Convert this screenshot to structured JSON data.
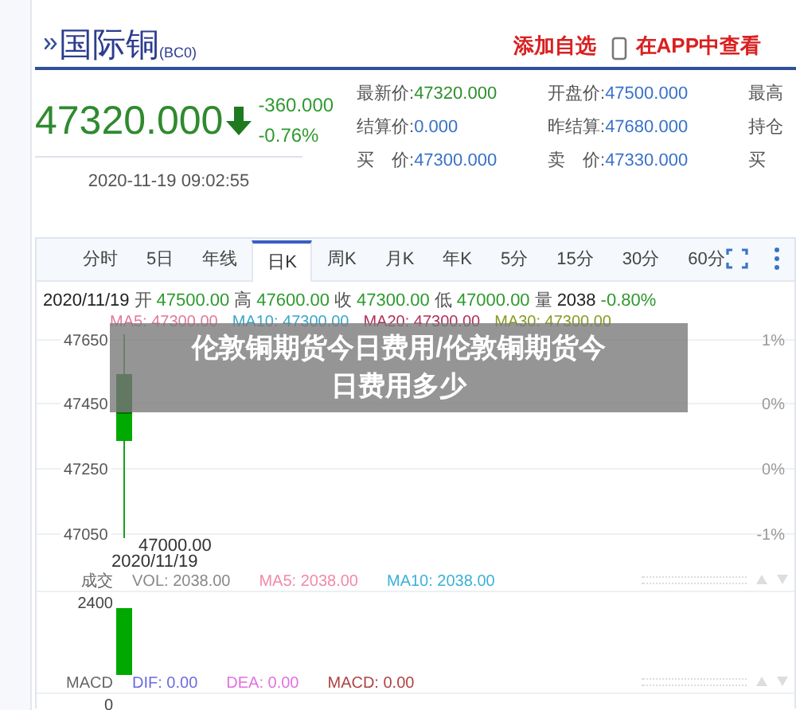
{
  "header": {
    "title": "国际铜",
    "code": "(BC0)",
    "add_watchlist": "添加自选",
    "open_in_app": "在APP中查看"
  },
  "quote": {
    "price": "47320.000",
    "change": "-360.000",
    "change_pct": "-0.76%",
    "time": "2020-11-19 09:02:55"
  },
  "stats": [
    [
      {
        "label": "最新价:",
        "value": "47320.000",
        "color": "#2f8f2f"
      },
      {
        "label": "结算价:",
        "value": "0.000",
        "color": "#3a72c8"
      },
      {
        "label": "买　价:",
        "value": "47300.000",
        "color": "#3a72c8"
      }
    ],
    [
      {
        "label": "开盘价:",
        "value": "47500.000",
        "color": "#3a72c8"
      },
      {
        "label": "昨结算:",
        "value": "47680.000",
        "color": "#3a72c8"
      },
      {
        "label": "卖　价:",
        "value": "47330.000",
        "color": "#3a72c8"
      }
    ],
    [
      {
        "label": "最高"
      },
      {
        "label": "持仓"
      },
      {
        "label": "买"
      }
    ]
  ],
  "tabs": [
    {
      "label": "分时",
      "selected": false
    },
    {
      "label": "5日",
      "selected": false
    },
    {
      "label": "年线",
      "selected": false
    },
    {
      "label": "日K",
      "selected": true
    },
    {
      "label": "周K",
      "selected": false
    },
    {
      "label": "月K",
      "selected": false
    },
    {
      "label": "年K",
      "selected": false
    },
    {
      "label": "5分",
      "selected": false
    },
    {
      "label": "15分",
      "selected": false
    },
    {
      "label": "30分",
      "selected": false
    },
    {
      "label": "60分",
      "selected": false
    }
  ],
  "ohlc": [
    {
      "text": "2020/11/19",
      "color": "#222222"
    },
    {
      "text": "开",
      "color": "#555555"
    },
    {
      "text": "47500.00",
      "color": "#2f9a2f"
    },
    {
      "text": "高",
      "color": "#555555"
    },
    {
      "text": "47600.00",
      "color": "#2f9a2f"
    },
    {
      "text": "收",
      "color": "#555555"
    },
    {
      "text": "47300.00",
      "color": "#2f9a2f"
    },
    {
      "text": "低",
      "color": "#555555"
    },
    {
      "text": "47000.00",
      "color": "#2f9a2f"
    },
    {
      "text": "量",
      "color": "#555555"
    },
    {
      "text": "2038",
      "color": "#222222"
    },
    {
      "text": "-0.80%",
      "color": "#2f9a2f"
    }
  ],
  "ma_legend": [
    {
      "text": "MA5: 47300.00",
      "color": "#e07a9a"
    },
    {
      "text": "MA10: 47300.00",
      "color": "#3aa7c8"
    },
    {
      "text": "MA20: 47300.00",
      "color": "#b0305a"
    },
    {
      "text": "MA30: 47300.00",
      "color": "#8a9a20"
    }
  ],
  "price_axis": [
    "47650",
    "47450",
    "47250",
    "47050"
  ],
  "pct_axis": [
    "1%",
    "0%",
    "0%",
    "-1%"
  ],
  "low_label": "47000.00",
  "date_label": "2020/11/19",
  "volume": {
    "label": "成交",
    "axis": "2400",
    "legend": [
      {
        "text": "VOL: 2038.00",
        "color": "#888888"
      },
      {
        "text": "MA5: 2038.00",
        "color": "#f08aa8"
      },
      {
        "text": "MA10: 2038.00",
        "color": "#3ab0d8"
      }
    ]
  },
  "macd": {
    "label": "MACD",
    "axis": "0",
    "legend": [
      {
        "text": "DIF: 0.00",
        "color": "#6a6ae0"
      },
      {
        "text": "DEA: 0.00",
        "color": "#e070e0"
      },
      {
        "text": "MACD: 0.00",
        "color": "#b04040"
      }
    ]
  },
  "banner": {
    "lines": [
      "伦敦铜期货今日费用/伦敦铜期货今",
      "日费用多少"
    ]
  }
}
